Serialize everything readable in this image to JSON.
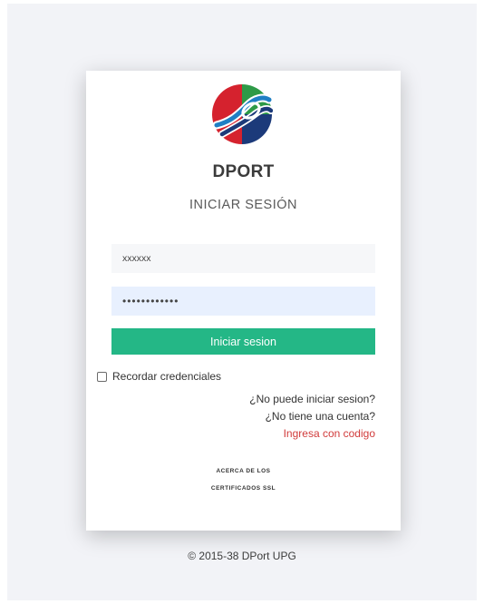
{
  "brand": {
    "name": "DPORT",
    "subtitle": "INICIAR SESIÓN"
  },
  "form": {
    "username_value": "xxxxxx",
    "password_value": "••••••••••••",
    "submit_label": "Iniciar sesion",
    "remember_label": "Recordar credenciales"
  },
  "links": {
    "cannot_login": "¿No puede iniciar sesion?",
    "no_account": "¿No tiene una cuenta?",
    "code_login": "Ingresa con codigo"
  },
  "ssl": {
    "line1": "ACERCA DE LOS",
    "line2": "CERTIFICADOS SSL"
  },
  "footer": {
    "copyright": "© 2015-38 DPort UPG"
  },
  "colors": {
    "accent": "#24b786",
    "link_red": "#d13b3b",
    "logo_green": "#2e9a47",
    "logo_red": "#d5222e",
    "logo_blue": "#1c3a7a"
  }
}
